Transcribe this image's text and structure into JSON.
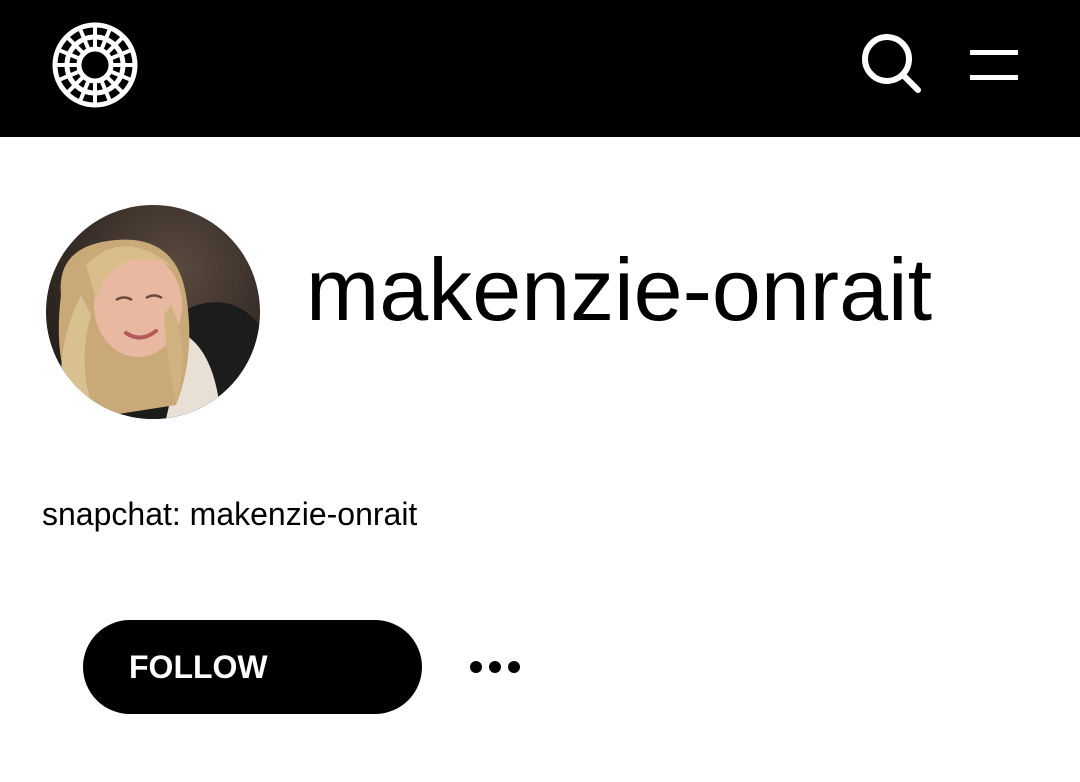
{
  "header": {
    "logo_icon": "vsco-logo-icon",
    "search_icon": "search-icon",
    "menu_icon": "hamburger-menu-icon",
    "background": "#000000",
    "icon_color": "#ffffff"
  },
  "profile": {
    "username": "makenzie-onrait",
    "bio": "snapchat: makenzie-onrait",
    "follow_label": "FOLLOW",
    "more_icon": "more-options-icon"
  }
}
